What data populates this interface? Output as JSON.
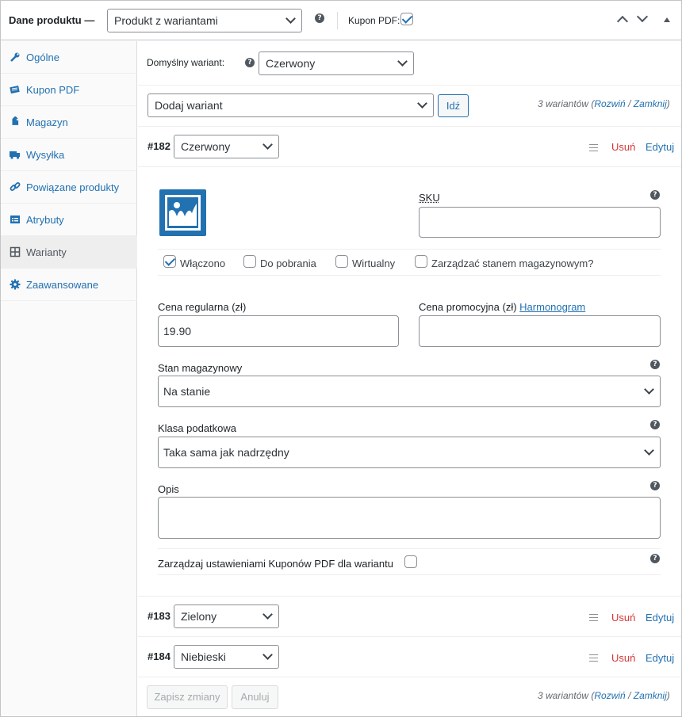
{
  "header": {
    "title": "Dane produktu —",
    "product_type": "Produkt z wariantami",
    "kupon_label": "Kupon PDF:",
    "kupon_checked": true
  },
  "sidebar": {
    "items": [
      {
        "label": "Ogólne",
        "icon": "wrench-icon"
      },
      {
        "label": "Kupon PDF",
        "icon": "coupon-icon"
      },
      {
        "label": "Magazyn",
        "icon": "tag-icon"
      },
      {
        "label": "Wysyłka",
        "icon": "truck-icon"
      },
      {
        "label": "Powiązane produkty",
        "icon": "link-icon"
      },
      {
        "label": "Atrybuty",
        "icon": "list-icon"
      },
      {
        "label": "Warianty",
        "icon": "grid-icon"
      },
      {
        "label": "Zaawansowane",
        "icon": "gear-icon"
      }
    ],
    "active": "Warianty"
  },
  "defaults": {
    "label": "Domyślny wariant:",
    "value": "Czerwony"
  },
  "add": {
    "select": "Dodaj wariant",
    "go_button": "Idź",
    "count_prefix": "3 wariantów (",
    "expand": "Rozwiń",
    "slash": " / ",
    "collapse": "Zamknij",
    "count_suffix": ")"
  },
  "variations": [
    {
      "num": "#182",
      "value": "Czerwony",
      "remove": "Usuń",
      "edit": "Edytuj"
    },
    {
      "num": "#183",
      "value": "Zielony",
      "remove": "Usuń",
      "edit": "Edytuj"
    },
    {
      "num": "#184",
      "value": "Niebieski",
      "remove": "Usuń",
      "edit": "Edytuj"
    }
  ],
  "variation_form": {
    "sku_label": "SKU",
    "sku_value": "",
    "checkboxes": [
      {
        "label": "Włączono",
        "checked": true
      },
      {
        "label": "Do pobrania",
        "checked": false
      },
      {
        "label": "Wirtualny",
        "checked": false
      },
      {
        "label": "Zarządzać stanem magazynowym?",
        "checked": false
      }
    ],
    "regular_price_label": "Cena regularna (zł)",
    "regular_price_value": "19.90",
    "sale_price_label": "Cena promocyjna (zł)",
    "schedule_link": "Harmonogram",
    "sale_price_value": "",
    "stock_label": "Stan magazynowy",
    "stock_value": "Na stanie",
    "tax_label": "Klasa podatkowa",
    "tax_value": "Taka sama jak nadrzędny",
    "desc_label": "Opis",
    "desc_value": "",
    "coupon_settings_label": "Zarządzaj ustawieniami Kuponów PDF dla wariantu",
    "coupon_settings_checked": false
  },
  "footer": {
    "save": "Zapisz zmiany",
    "cancel": "Anuluj",
    "count_prefix": "3 wariantów (",
    "expand": "Rozwiń",
    "slash": " / ",
    "collapse": "Zamknij",
    "count_suffix": ")"
  },
  "colors": {
    "accent": "#2271b1",
    "danger": "#d63638",
    "image_placeholder": "#2271b1"
  }
}
